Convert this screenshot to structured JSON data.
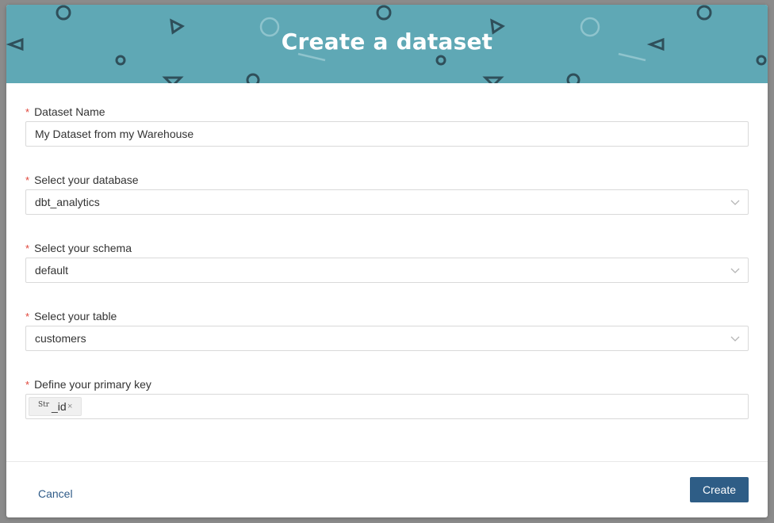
{
  "modal": {
    "title": "Create a dataset",
    "header_color": "#5fa8b5"
  },
  "form": {
    "required_marker": "*",
    "dataset_name": {
      "label": "Dataset Name",
      "value": "My Dataset from my Warehouse"
    },
    "database": {
      "label": "Select your database",
      "value": "dbt_analytics",
      "icon": "chevron-down-icon"
    },
    "schema": {
      "label": "Select your schema",
      "value": "default",
      "icon": "chevron-down-icon"
    },
    "table": {
      "label": "Select your table",
      "value": "customers",
      "icon": "chevron-down-icon"
    },
    "primary_key": {
      "label": "Define your primary key",
      "tags": [
        {
          "type": "Str",
          "name": "_id",
          "remove": "×"
        }
      ]
    }
  },
  "footer": {
    "cancel_label": "Cancel",
    "create_label": "Create",
    "create_color": "#2e5d86"
  }
}
